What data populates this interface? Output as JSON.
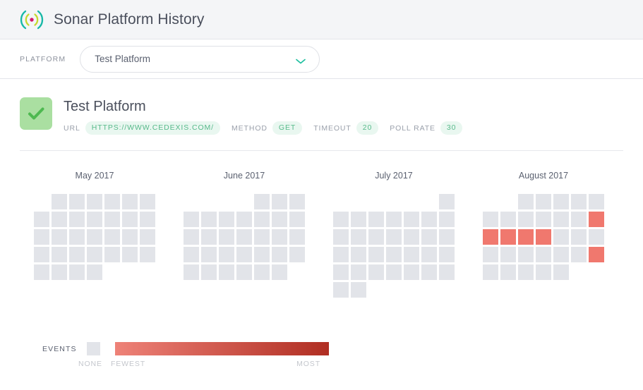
{
  "header": {
    "title": "Sonar Platform History",
    "logo_icon": "sonar-icon"
  },
  "platform_selector": {
    "label": "PLATFORM",
    "selected": "Test Platform",
    "chevron_icon": "chevron-down-icon"
  },
  "platform_info": {
    "status_icon": "check-icon",
    "name": "Test Platform",
    "meta": [
      {
        "key": "URL",
        "value": "HTTPS://WWW.CEDEXIS.COM/"
      },
      {
        "key": "METHOD",
        "value": "GET"
      },
      {
        "key": "TIMEOUT",
        "value": "20"
      },
      {
        "key": "POLL RATE",
        "value": "30"
      }
    ]
  },
  "calendar": {
    "months": [
      {
        "title": "May 2017",
        "offset": 1,
        "days": 31,
        "events": {}
      },
      {
        "title": "June 2017",
        "offset": 4,
        "days": 30,
        "events": {}
      },
      {
        "title": "July 2017",
        "offset": 6,
        "days": 31,
        "events": {}
      },
      {
        "title": "August 2017",
        "offset": 2,
        "days": 31,
        "events": {
          "12": 1,
          "13": 1,
          "14": 1,
          "15": 1,
          "16": 1,
          "26": 1
        }
      }
    ]
  },
  "legend": {
    "title": "EVENTS",
    "none_label": "NONE",
    "fewest_label": "FEWEST",
    "most_label": "MOST"
  },
  "colors": {
    "header_bg": "#f4f5f7",
    "empty_cell": "#e2e4e9",
    "event_low": "#f0786e",
    "gradient_start": "#ee8278",
    "gradient_end": "#b02e22",
    "accent_teal": "#1dbf9f",
    "status_green": "#aadfa1",
    "pill_text": "#57b98a",
    "pill_bg": "#e9f7f0"
  }
}
